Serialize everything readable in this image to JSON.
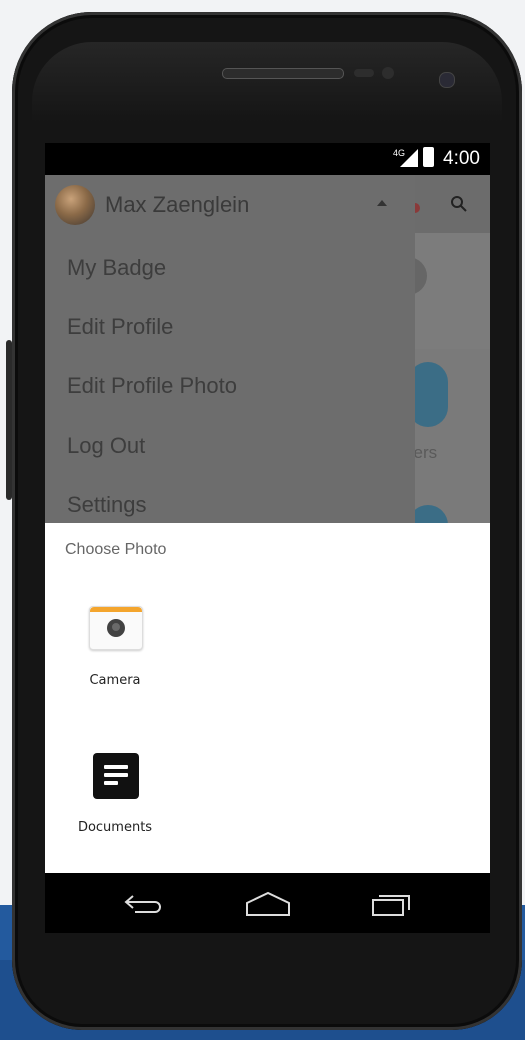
{
  "status_bar": {
    "network": "4G",
    "time": "4:00"
  },
  "drawer": {
    "account_name": "Max Zaenglein",
    "items": [
      {
        "label": "My Badge"
      },
      {
        "label": "Edit Profile"
      },
      {
        "label": "Edit Profile Photo"
      },
      {
        "label": "Log Out"
      },
      {
        "label": "Settings"
      }
    ]
  },
  "background_app": {
    "partial_text": "kers"
  },
  "chooser": {
    "title": "Choose Photo",
    "options": [
      {
        "label": "Camera",
        "icon": "camera-app-icon"
      },
      {
        "label": "Documents",
        "icon": "documents-app-icon"
      }
    ]
  },
  "navbar": {
    "back_icon": "back-icon",
    "home_icon": "home-icon",
    "recent_icon": "recent-apps-icon"
  },
  "colors": {
    "camera_accent": "#f4a52d",
    "background_blue": "#235a9e"
  }
}
